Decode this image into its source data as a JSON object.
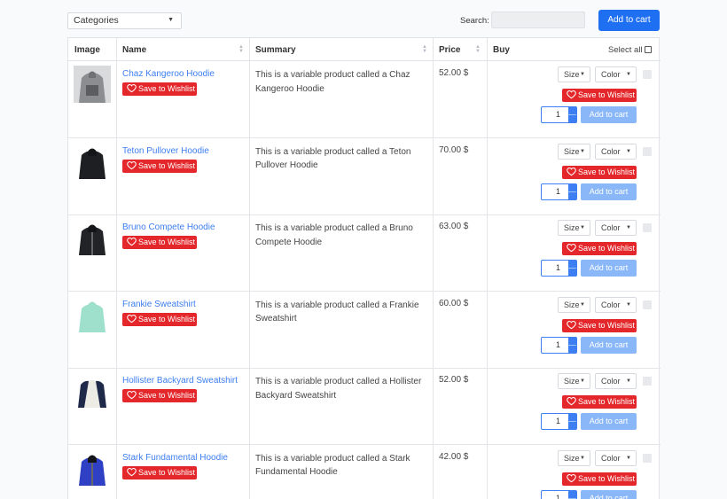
{
  "toolbar": {
    "category_select": "Categories",
    "search_label": "Search:",
    "search_value": "",
    "add_to_cart_label": "Add to cart"
  },
  "table": {
    "headers": {
      "image": "Image",
      "name": "Name",
      "summary": "Summary",
      "price": "Price",
      "buy": "Buy",
      "select_all": "Select all"
    },
    "rows": [
      {
        "name": "Chaz Kangeroo Hoodie",
        "summary": "This is a variable product called a Chaz Kangeroo Hoodie",
        "price": "52.00 $",
        "qty": "1",
        "product_color": "#8b8d90",
        "variant": "kangaroo"
      },
      {
        "name": "Teton Pullover Hoodie",
        "summary": "This is a variable product called a Teton Pullover Hoodie",
        "price": "70.00 $",
        "qty": "1",
        "product_color": "#1e1f22",
        "variant": "hoodie"
      },
      {
        "name": "Bruno Compete Hoodie",
        "summary": "This is a variable product called a Bruno Compete Hoodie",
        "price": "63.00 $",
        "qty": "1",
        "product_color": "#222326",
        "variant": "zip"
      },
      {
        "name": "Frankie Sweatshirt",
        "summary": "This is a variable product called a Frankie Sweatshirt",
        "price": "60.00 $",
        "qty": "1",
        "product_color": "#9fe0cc",
        "variant": "crew"
      },
      {
        "name": "Hollister Backyard Sweatshirt",
        "summary": "This is a variable product called a Hollister Backyard Sweatshirt",
        "price": "52.00 $",
        "qty": "1",
        "product_color": "#ecebe6",
        "variant": "raglan"
      },
      {
        "name": "Stark Fundamental Hoodie",
        "summary": "This is a variable product called a Stark Fundamental Hoodie",
        "price": "42.00 $",
        "qty": "1",
        "product_color": "#3040c4",
        "variant": "zip"
      }
    ],
    "row_labels": {
      "wishlist": "Save to Wishlist",
      "size": "Size",
      "color": "Color",
      "add_to_cart": "Add to cart"
    }
  },
  "colors": {
    "primary": "#1f6ff3",
    "wishlist_red": "#e3272b",
    "link_blue": "#3d7ef2",
    "cart_disabled": "#8ab7f8"
  },
  "icons": [
    "chevron-down-icon",
    "sort-icon",
    "heart-icon",
    "spinner-arrows-icon",
    "checkbox-icon"
  ]
}
